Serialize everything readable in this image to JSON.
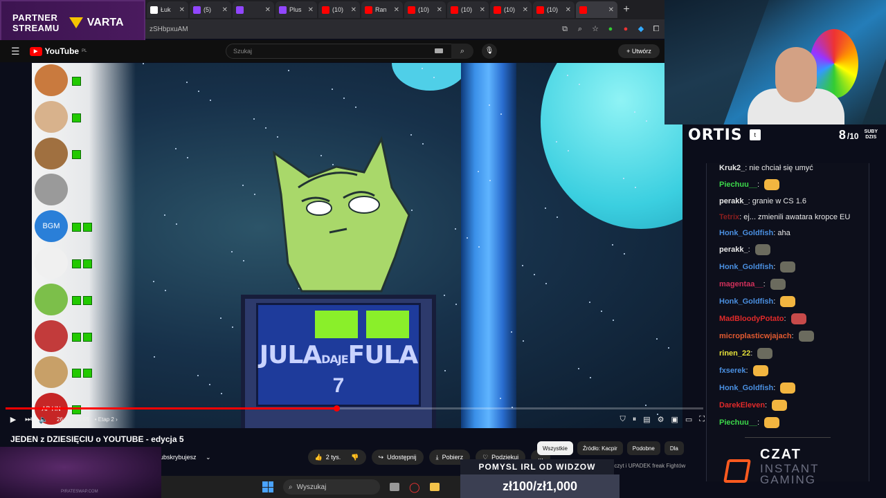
{
  "partner": {
    "line1": "PARTNER",
    "line2": "STREAMU",
    "brand": "VARTA"
  },
  "browser": {
    "tabs": [
      {
        "icon": "x-icon",
        "label": "Łuk",
        "color": "#ffffff"
      },
      {
        "icon": "twitch-icon",
        "label": "(5)",
        "color": "#9146ff"
      },
      {
        "icon": "twitch-icon",
        "label": "",
        "color": "#9146ff"
      },
      {
        "icon": "twitch-icon",
        "label": "Plus",
        "color": "#9146ff"
      },
      {
        "icon": "youtube-icon",
        "label": "(10)",
        "color": "#ff0000"
      },
      {
        "icon": "youtube-icon",
        "label": "Ran",
        "color": "#ff0000"
      },
      {
        "icon": "youtube-icon",
        "label": "(10)",
        "color": "#ff0000"
      },
      {
        "icon": "youtube-icon",
        "label": "(10)",
        "color": "#ff0000"
      },
      {
        "icon": "youtube-icon",
        "label": "(10)",
        "color": "#ff0000"
      },
      {
        "icon": "youtube-icon",
        "label": "(10)",
        "color": "#ff0000"
      },
      {
        "icon": "youtube-icon",
        "label": "",
        "color": "#ff0000"
      }
    ],
    "url": "zSHbpxuAM"
  },
  "youtube": {
    "logo": "YouTube",
    "region": "PL",
    "search_placeholder": "Szukaj",
    "create_label": "Utwórz"
  },
  "video": {
    "sign_jula": "JULA",
    "sign_daje": "DAJE",
    "sign_fula": "FULA",
    "sign_number": "7",
    "player_lives": [
      1,
      1,
      1,
      0,
      2,
      2,
      2,
      2,
      2,
      1
    ],
    "player_colors": [
      "#c97a3e",
      "#d8b28c",
      "#a07040",
      "#9a9a9a",
      "#2a7fd8",
      "#f0f0f0",
      "#7cbf4a",
      "#c23b3b",
      "#c8a068",
      "#c62626"
    ],
    "player_label_bgm": "BGM",
    "player_label_ap": "AP HN"
  },
  "player": {
    "progress": 0.474,
    "time": "26:18 / 55:55",
    "chapter": "Etap 2"
  },
  "below": {
    "title": "JEDEN z DZIESIĘCIU o YOUTUBE - edycja 5",
    "subscribed": "Subskrybujesz",
    "likes": "2 tys.",
    "share": "Udostępnij",
    "download": "Pobierz",
    "thanks": "Podziękuj",
    "more": "...",
    "chips": [
      "Wszystkie",
      "Źródło: Kacpir",
      "Podobne",
      "Dla"
    ],
    "side_info": "Szczyt i UPADEK freak Fightów"
  },
  "overlay": {
    "pomysl": "POMYSL IRL OD WIDZOW",
    "price": "zł100/zł1,000",
    "promo": "PIRATESWAP.COM"
  },
  "taskbar": {
    "search": "Wyszukaj"
  },
  "ortis": {
    "name": "ORTIS",
    "subs_count": "8",
    "subs_goal": "/10",
    "subs_label_1": "SUBY",
    "subs_label_2": "DZIS"
  },
  "chat": {
    "messages": [
      {
        "user": "Kruk2_",
        "color": "#e8e8e8",
        "text": "nie chciał się umyć",
        "emote": ""
      },
      {
        "user": "Piechuu__",
        "color": "#3cd84a",
        "text": "",
        "emote": "#f2b540"
      },
      {
        "user": "perakk_",
        "color": "#e8e8e8",
        "text": "granie w CS 1.6",
        "emote": ""
      },
      {
        "user": "Tetrix",
        "color": "#8a1e1e",
        "text": "ej... zmienili awatara kropce EU",
        "emote": ""
      },
      {
        "user": "Honk_Goldfish",
        "color": "#4a8fe0",
        "text": "aha",
        "emote": ""
      },
      {
        "user": "perakk_",
        "color": "#e8e8e8",
        "text": "",
        "emote": "#6b6b5e"
      },
      {
        "user": "Honk_Goldfish",
        "color": "#4a8fe0",
        "text": "",
        "emote": "#6b6b5e"
      },
      {
        "user": "magentaa__",
        "color": "#d0305a",
        "text": "",
        "emote": "#6b6b5e"
      },
      {
        "user": "Honk_Goldfish",
        "color": "#4a8fe0",
        "text": "",
        "emote": "#f2b540"
      },
      {
        "user": "MadBloodyPotato",
        "color": "#e02a2a",
        "text": "",
        "emote": "#c74a4a"
      },
      {
        "user": "microplasticwjajach",
        "color": "#e25a30",
        "text": "",
        "emote": "#6b6b5e"
      },
      {
        "user": "rinen_22",
        "color": "#e5e03a",
        "text": "",
        "emote": "#6b6b5e"
      },
      {
        "user": "fxserek",
        "color": "#4a8fe0",
        "text": "",
        "emote": "#f2b540"
      },
      {
        "user": "Honk_Goldfish",
        "color": "#4a8fe0",
        "text": "",
        "emote": "#f2b540"
      },
      {
        "user": "DarekEleven",
        "color": "#e02a2a",
        "text": "",
        "emote": "#f2b540"
      },
      {
        "user": "Piechuu__",
        "color": "#3cd84a",
        "text": "",
        "emote": "#f2b540"
      }
    ]
  },
  "czat_brand": {
    "line1": "CZAT",
    "line2": "INSTANT",
    "line3": "GAMING"
  }
}
